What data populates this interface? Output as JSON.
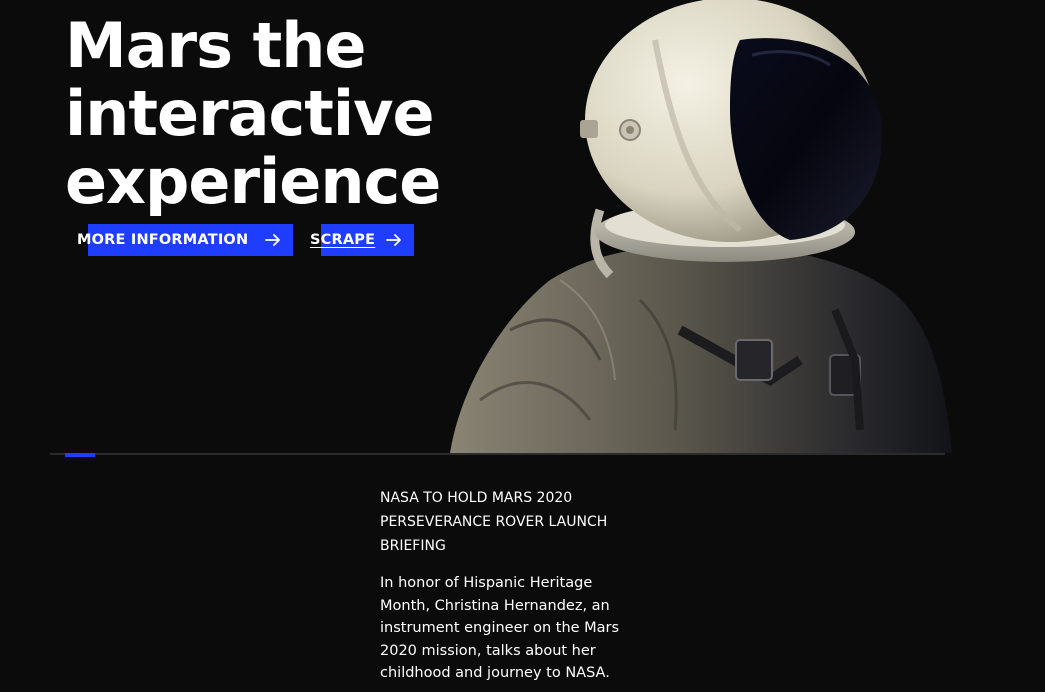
{
  "hero": {
    "title_lines": [
      "Mars the",
      "interactive",
      "experience"
    ],
    "image_icon": "astronaut-illustration"
  },
  "actions": {
    "more_info_label": "MORE INFORMATION",
    "scrape_label": "SCRAPE",
    "arrow_icon": "arrow-right-icon"
  },
  "slider": {
    "active_index": 1,
    "progress_fraction": 0.03
  },
  "news": {
    "headline": "NASA TO HOLD MARS 2020 PERSEVERANCE ROVER LAUNCH BRIEFING",
    "body": "In honor of Hispanic Heritage Month, Christina Hernandez, an instrument engineer on the Mars 2020 mission, talks about her childhood and journey to NASA."
  },
  "colors": {
    "background": "#0b0b0b",
    "accent": "#1f3dff",
    "text": "#ffffff"
  }
}
